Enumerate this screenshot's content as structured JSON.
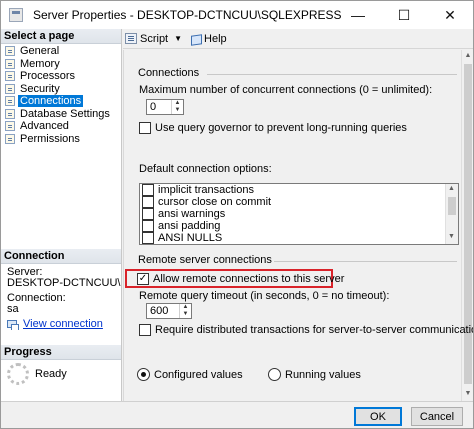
{
  "window": {
    "title": "Server Properties - DESKTOP-DCTNCUU\\SQLEXPRESS",
    "minimize": "—",
    "maximize": "☐",
    "close": "✕"
  },
  "left": {
    "select_page_heading": "Select a page",
    "pages": [
      "General",
      "Memory",
      "Processors",
      "Security",
      "Connections",
      "Database Settings",
      "Advanced",
      "Permissions"
    ],
    "selected_page": "Connections",
    "connection_heading": "Connection",
    "server_label": "Server:",
    "server_value": "DESKTOP-DCTNCUU\\SQ",
    "connection_label": "Connection:",
    "connection_value": "sa",
    "view_connection": "View connection",
    "progress_heading": "Progress",
    "progress_status": "Ready"
  },
  "toolbar": {
    "script": "Script",
    "help": "Help"
  },
  "connections": {
    "group_label": "Connections",
    "max_connections_label": "Maximum number of concurrent connections (0 = unlimited):",
    "max_connections_value": "0",
    "query_governor_label": "Use query governor to prevent long-running queries",
    "query_governor_checked": false,
    "default_options_label": "Default connection options:",
    "default_options": [
      {
        "label": "implicit transactions",
        "checked": false
      },
      {
        "label": "cursor close on commit",
        "checked": false
      },
      {
        "label": "ansi warnings",
        "checked": false
      },
      {
        "label": "ansi padding",
        "checked": false
      },
      {
        "label": "ANSI NULLS",
        "checked": false
      }
    ]
  },
  "remote": {
    "group_label": "Remote server connections",
    "allow_remote_label": "Allow remote connections to this server",
    "allow_remote_checked": true,
    "timeout_label": "Remote query timeout (in seconds, 0 = no timeout):",
    "timeout_value": "600",
    "distributed_label": "Require distributed transactions for server-to-server communication",
    "distributed_checked": false
  },
  "values_mode": {
    "configured": "Configured values",
    "running": "Running values",
    "selected": "configured"
  },
  "buttons": {
    "ok": "OK",
    "cancel": "Cancel"
  },
  "colors": {
    "selection": "#0078d7",
    "highlight_box": "#d9232a",
    "link": "#0033cc"
  }
}
